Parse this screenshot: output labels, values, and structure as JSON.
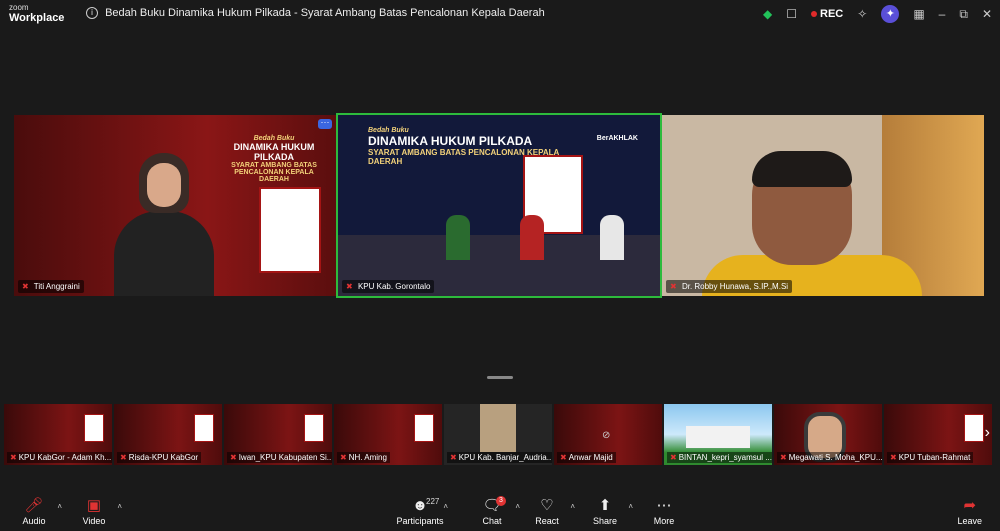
{
  "window": {
    "brand_small": "zoom",
    "brand_big": "Workplace",
    "meeting_title": "Bedah Buku Dinamika Hukum Pilkada - Syarat Ambang Batas Pencalonan Kepala Daerah",
    "rec_label": "REC",
    "controls": [
      "minimize",
      "restore",
      "close"
    ]
  },
  "tiles": [
    {
      "name": "Titi Anggraini",
      "active": false
    },
    {
      "name": "KPU Kab. Gorontalo",
      "active": true
    },
    {
      "name": "Dr. Robby Hunawa, S.IP.,M.Si",
      "active": false
    }
  ],
  "tile1_book": {
    "l1": "Bedah Buku",
    "l2": "DINAMIKA HUKUM PILKADA",
    "l3": "SYARAT AMBANG BATAS PENCALONAN KEPALA DAERAH"
  },
  "tile2_banner": {
    "l1": "Bedah Buku",
    "l2": "DINAMIKA HUKUM PILKADA",
    "l3": "SYARAT AMBANG BATAS PENCALONAN KEPALA DAERAH",
    "berakhlak": "BerAKHLAK"
  },
  "thumbnails": [
    {
      "name": "KPU KabGor - Adam Kh..."
    },
    {
      "name": "Risda-KPU KabGor"
    },
    {
      "name": "Iwan_KPU Kabupaten Si..."
    },
    {
      "name": "NH. Aming"
    },
    {
      "name": "KPU Kab. Banjar_Audria..."
    },
    {
      "name": "Anwar Majid"
    },
    {
      "name": "BINTAN_kepri_syamsul ..."
    },
    {
      "name": "Megawati S. Moha_KPU..."
    },
    {
      "name": "KPU Tuban-Rahmat"
    }
  ],
  "toolbar": {
    "audio": "Audio",
    "video": "Video",
    "participants": "Participants",
    "participants_count": "227",
    "chat": "Chat",
    "chat_badge": "3",
    "react": "React",
    "share": "Share",
    "more": "More",
    "leave": "Leave"
  },
  "colors": {
    "background": "#1a1a1a",
    "active_speaker": "#2dbb3c",
    "muted": "#e03333",
    "ai_companion": "#5a4fd8"
  }
}
